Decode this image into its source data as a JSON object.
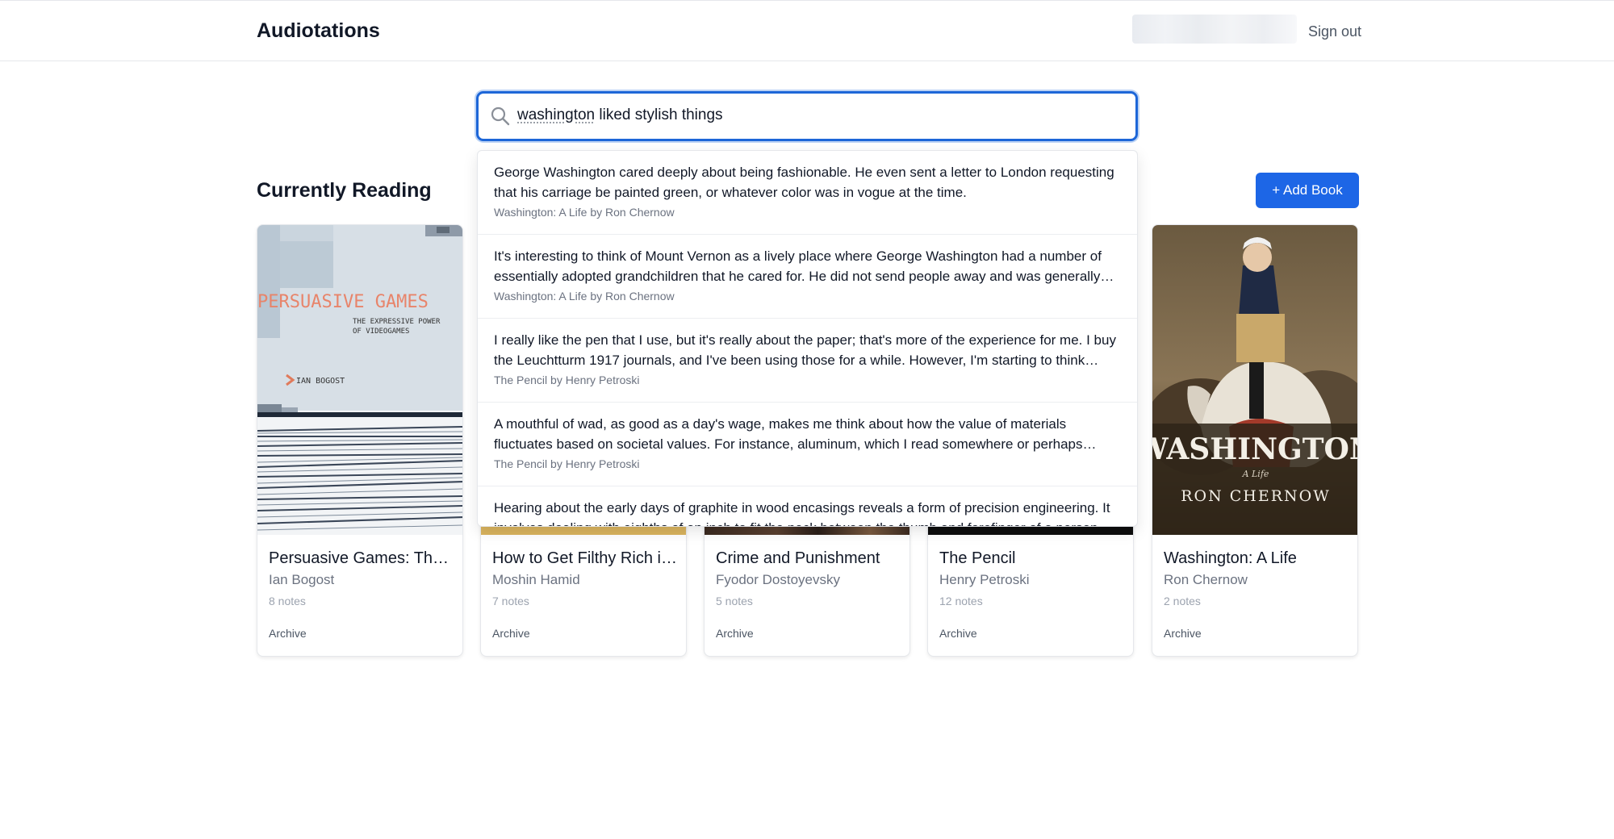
{
  "header": {
    "app_title": "Audiotations",
    "sign_out": "Sign out"
  },
  "search": {
    "value_highlight": "washington",
    "value_rest": " liked stylish things",
    "icon": "search-icon"
  },
  "results": [
    {
      "text": "George Washington cared deeply about being fashionable. He even sent a letter to London requesting that his carriage be painted green, or whatever color was in vogue at the time.",
      "source": "Washington: A Life by Ron Chernow"
    },
    {
      "text": "It's interesting to think of Mount Vernon as a lively place where George Washington had a number of essentially adopted grandchildren that he cared for. He did not send people away and was generally welcoming to visitors.",
      "source": "Washington: A Life by Ron Chernow"
    },
    {
      "text": "I really like the pen that I use, but it's really about the paper; that's more of the experience for me. I buy the Leuchtturm 1917 journals, and I've been using those for a while. However, I'm starting to think about other options.",
      "source": "The Pencil by Henry Petroski"
    },
    {
      "text": "A mouthful of wad, as good as a day's wage, makes me think about how the value of materials fluctuates based on societal values. For instance, aluminum, which I read somewhere or perhaps heard once was worth more than gold.",
      "source": "The Pencil by Henry Petroski"
    },
    {
      "text": "Hearing about the early days of graphite in wood encasings reveals a form of precision engineering. It involves dealing with eighths of an inch to fit the neck between the thumb and forefinger of a person.",
      "source": ""
    }
  ],
  "main": {
    "section_title": "Currently Reading",
    "add_book": "+ Add Book",
    "archive_label": "Archive"
  },
  "books": [
    {
      "title": "Persuasive Games: The Expressive Power of Videogames",
      "author": "Ian Bogost",
      "notes": "8 notes",
      "cover": {
        "title": "PERSUASIVE GAMES",
        "subtitle_line1": "THE EXPRESSIVE POWER",
        "subtitle_line2": "OF VIDEOGAMES",
        "author": "IAN BOGOST"
      }
    },
    {
      "title": "How to Get Filthy Rich in Rising Asia",
      "author": "Moshin Hamid",
      "notes": "7 notes"
    },
    {
      "title": "Crime and Punishment",
      "author": "Fyodor Dostoyevsky",
      "notes": "5 notes"
    },
    {
      "title": "The Pencil",
      "author": "Henry Petroski",
      "notes": "12 notes"
    },
    {
      "title": "Washington: A Life",
      "author": "Ron Chernow",
      "notes": "2 notes",
      "cover": {
        "title": "WASHINGTON",
        "subtitle": "A Life",
        "author": "RON CHERNOW"
      }
    }
  ],
  "colors": {
    "accent": "#1d66e6",
    "focus_ring": "#1d66d8",
    "muted_text": "#6b7280"
  }
}
